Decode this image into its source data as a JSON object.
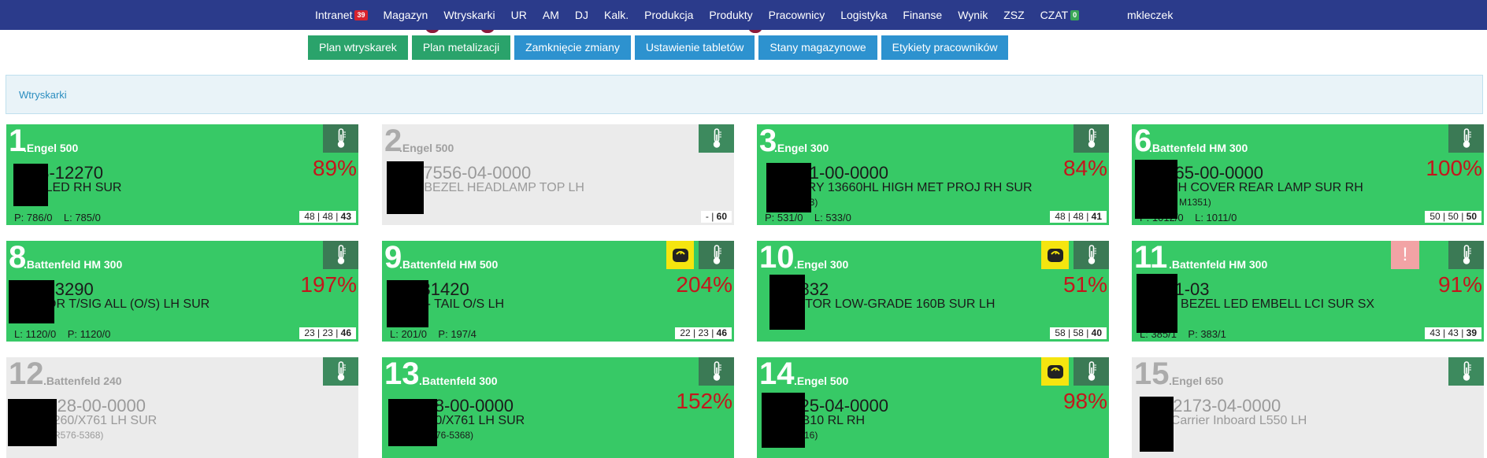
{
  "nav": {
    "items": [
      {
        "label": "Intranet",
        "badge": "39",
        "badge_color": "#d9232d"
      },
      {
        "label": "Magazyn"
      },
      {
        "label": "Wtryskarki"
      },
      {
        "label": "UR"
      },
      {
        "label": "AM"
      },
      {
        "label": "DJ"
      },
      {
        "label": "Kalk."
      },
      {
        "label": "Produkcja"
      },
      {
        "label": "Produkty"
      },
      {
        "label": "Pracownicy"
      },
      {
        "label": "Logistyka"
      },
      {
        "label": "Finanse"
      },
      {
        "label": "Wynik"
      },
      {
        "label": "ZSZ"
      },
      {
        "label": "CZAT",
        "badge": "0",
        "badge_color": "#3aa657"
      }
    ],
    "user": "mkleczek"
  },
  "actions": [
    {
      "label": "Plan wtryskarek",
      "color": "green"
    },
    {
      "label": "Plan metalizacji",
      "color": "green"
    },
    {
      "label": "Zamknięcie zmiany",
      "color": "blue"
    },
    {
      "label": "Ustawienie tabletów",
      "color": "blue"
    },
    {
      "label": "Stany magazynowe",
      "color": "blue"
    },
    {
      "label": "Etykiety pracowników",
      "color": "blue"
    }
  ],
  "breadcrumb": "Wtryskarki",
  "machines": [
    {
      "num": "1",
      "name": ".Engel 500",
      "state": "active",
      "pct": "89%",
      "part": "23-12270",
      "desc": "/S LED RH SUR",
      "sub": "",
      "stats": "P: 786/0    L: 785/0",
      "counts": "48 | 48 | ",
      "counts_b": "43",
      "scale": false,
      "warn": false
    },
    {
      "num": "2",
      "name": ".Engel 500",
      "state": "idle",
      "pct": "",
      "part": "17556-04-0000",
      "desc": "6 BEZEL HEADLAMP TOP LH",
      "sub": "",
      "stats": "",
      "counts": "- | ",
      "counts_b": "60",
      "scale": false,
      "warn": false
    },
    {
      "num": "3",
      "name": ".Engel 300",
      "state": "active",
      "pct": "84%",
      "part": "5981-00-0000",
      "desc": "ECDRY 13660HL HIGH MET PROJ RH SUR",
      "sub": "83)",
      "stats": "P: 531/0    L: 533/0",
      "counts": "48 | 48 | ",
      "counts_b": "41",
      "scale": false,
      "warn": false
    },
    {
      "num": "6",
      "name": ".Battenfeld HM 300",
      "state": "active",
      "pct": "100%",
      "part": "2765-00-0000",
      "desc": "HIGH COVER REAR LAMP SUR RH",
      "sub": "M1351)",
      "stats": "P: 1012/0    L: 1011/0",
      "counts": "50 | 50 | ",
      "counts_b": "50",
      "scale": false,
      "warn": false
    },
    {
      "num": "8",
      "name": ".Battenfeld HM 300",
      "state": "active",
      "pct": "197%",
      "part": "3-03290",
      "desc": "CTOR T/SIG ALL (O/S) LH SUR",
      "sub": "",
      "stats": "L: 1120/0    P: 1120/0",
      "counts": "23 | 23 | ",
      "counts_b": "46",
      "scale": false,
      "warn": false
    },
    {
      "num": "9",
      "name": ".Battenfeld HM 500",
      "state": "active",
      "pct": "204%",
      "part": "4-31420",
      "desc": "NS - TAIL O/S LH",
      "sub": "",
      "stats": "L: 201/0    P: 197/4",
      "counts": "22 | 23 | ",
      "counts_b": "46",
      "scale": true,
      "warn": false
    },
    {
      "num": "10",
      "name": ".Engel 300",
      "state": "active",
      "pct": "51%",
      "part": "53832",
      "desc": "LECTOR LOW-GRADE 160B SUR LH",
      "sub": "",
      "stats": "",
      "counts": "58 | 58 | ",
      "counts_b": "40",
      "scale": true,
      "warn": false
    },
    {
      "num": "11",
      "name": ".Battenfeld HM 300",
      "state": "active",
      "pct": "91%",
      "part": "671-03",
      "desc": "F30 BEZEL LED EMBELL LCI SUR SX",
      "sub": "",
      "stats": "L: 385/1    P: 383/1",
      "counts": "43 | 43 | ",
      "counts_b": "39",
      "scale": false,
      "warn": true
    },
    {
      "num": "12",
      "name": ".Battenfeld 240",
      "state": "idle",
      "pct": "",
      "part": "5328-00-0000",
      "desc": "I X260/X761 LH SUR",
      "sub": "R576-5368)",
      "stats": "",
      "counts": "",
      "counts_b": "",
      "scale": false,
      "warn": false
    },
    {
      "num": "13",
      "name": ".Battenfeld 300",
      "state": "active",
      "pct": "152%",
      "part": "5328-00-0000",
      "desc": "I X260/X761 LH SUR",
      "sub": "S76-5368)",
      "stats": "",
      "counts": "",
      "counts_b": "",
      "scale": false,
      "warn": false
    },
    {
      "num": "14",
      "name": ".Engel 500",
      "state": "active",
      "pct": "98%",
      "part": "1425-04-0000",
      "desc": "ER B10 RL RH",
      "sub": "16)",
      "stats": "",
      "counts": "",
      "counts_b": "",
      "scale": true,
      "warn": false
    },
    {
      "num": "15",
      "name": ".Engel 650",
      "state": "idle",
      "pct": "",
      "part": "12173-04-0000",
      "desc": "- Carrier Inboard L550 LH",
      "sub": "",
      "stats": "",
      "counts": "",
      "counts_b": "",
      "scale": false,
      "warn": false
    }
  ]
}
